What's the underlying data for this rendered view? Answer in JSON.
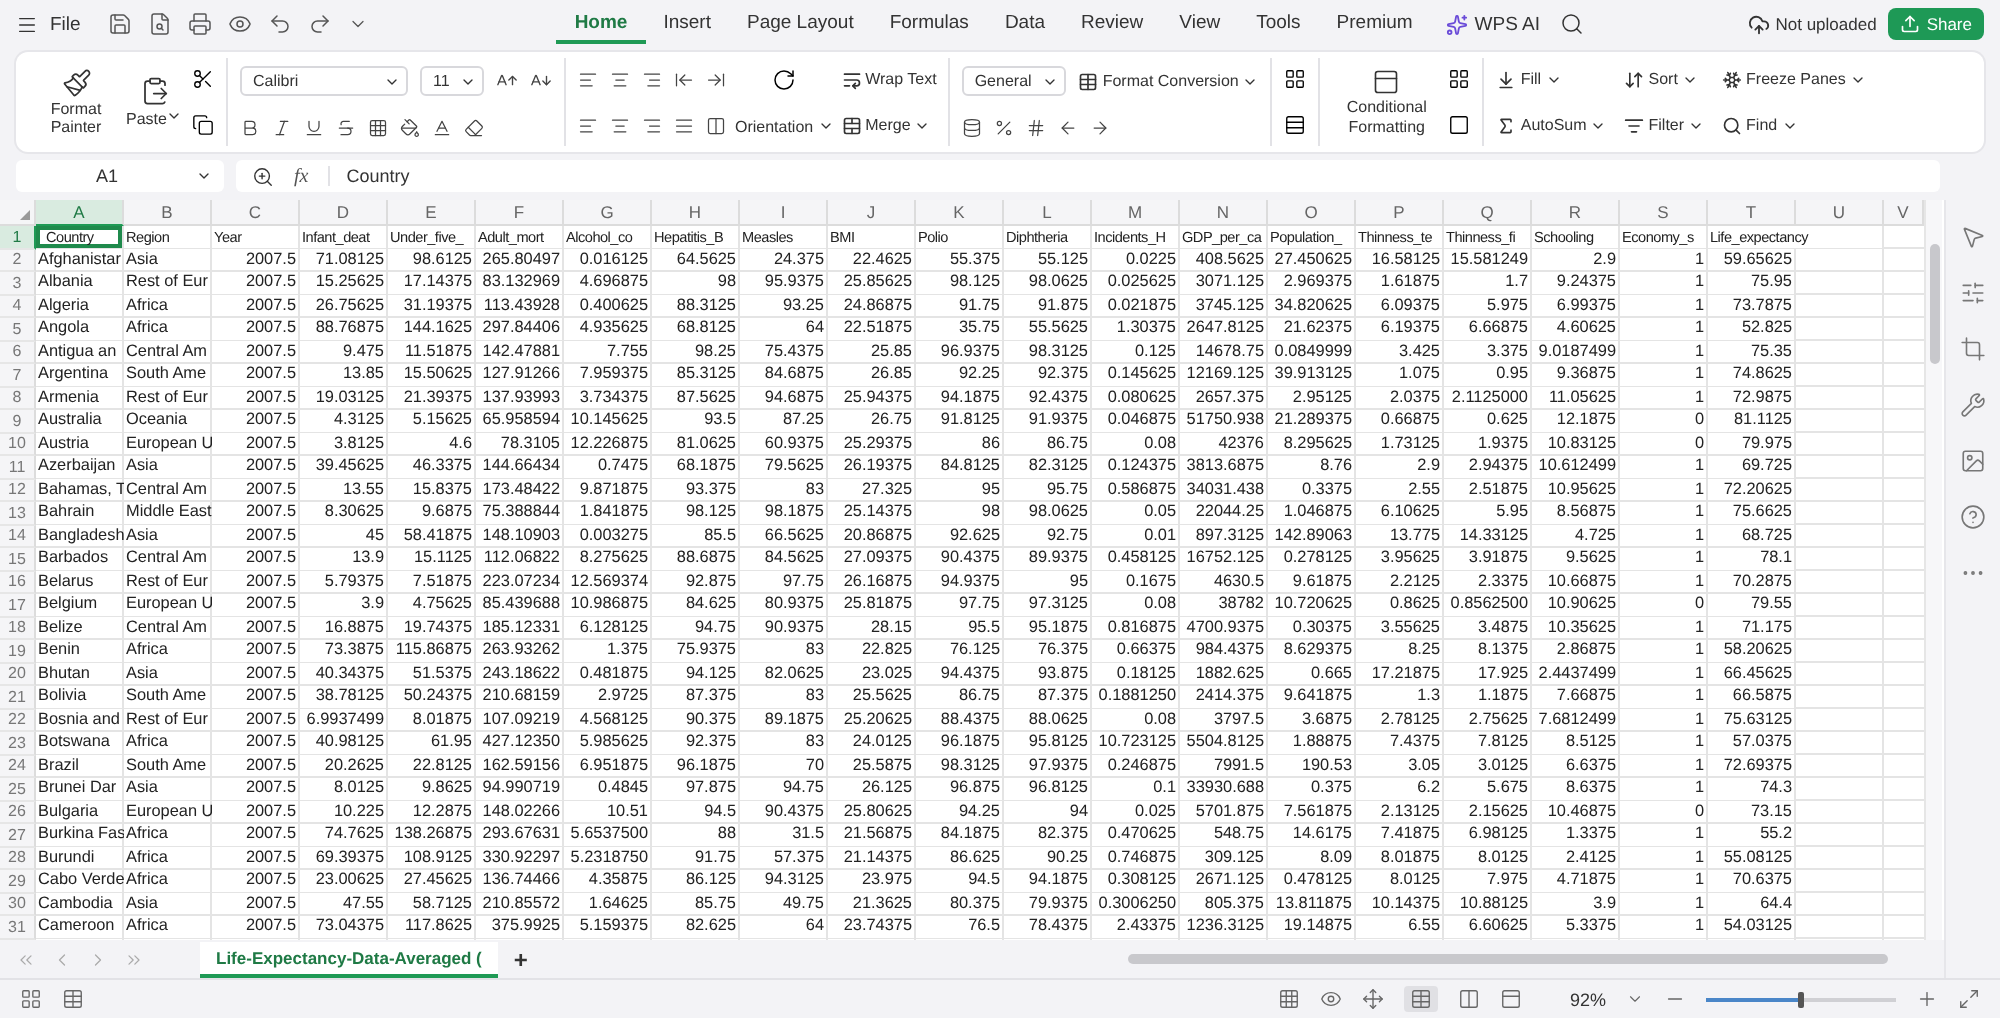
{
  "menu": {
    "file": "File",
    "tabs": [
      {
        "label": "Home",
        "selected": true
      },
      {
        "label": "Insert",
        "selected": false
      },
      {
        "label": "Page Layout",
        "selected": false
      },
      {
        "label": "Formulas",
        "selected": false
      },
      {
        "label": "Data",
        "selected": false
      },
      {
        "label": "Review",
        "selected": false
      },
      {
        "label": "View",
        "selected": false
      },
      {
        "label": "Tools",
        "selected": false
      },
      {
        "label": "Premium",
        "selected": false
      }
    ],
    "ai": "WPS AI",
    "cloud_status": "Not uploaded",
    "share": "Share"
  },
  "ribbon": {
    "format_painter": "Format Painter",
    "paste": "Paste",
    "font": "Calibri",
    "font_size": "11",
    "wrap_text": "Wrap Text",
    "orientation": "Orientation",
    "merge": "Merge",
    "number_format": "General",
    "format_conversion": "Format Conversion",
    "conditional_formatting": "Conditional Formatting",
    "fill": "Fill",
    "autosum": "AutoSum",
    "sort": "Sort",
    "filter": "Filter",
    "freeze_panes": "Freeze Panes",
    "find": "Find"
  },
  "formula_bar": {
    "name_box": "A1",
    "function_label": "fx",
    "value": "Country"
  },
  "sheet": {
    "columns": [
      {
        "letter": "A",
        "selected": true
      },
      {
        "letter": "B",
        "selected": false
      },
      {
        "letter": "C",
        "selected": false
      },
      {
        "letter": "D",
        "selected": false
      },
      {
        "letter": "E",
        "selected": false
      },
      {
        "letter": "F",
        "selected": false
      },
      {
        "letter": "G",
        "selected": false
      },
      {
        "letter": "H",
        "selected": false
      },
      {
        "letter": "I",
        "selected": false
      },
      {
        "letter": "J",
        "selected": false
      },
      {
        "letter": "K",
        "selected": false
      },
      {
        "letter": "L",
        "selected": false
      },
      {
        "letter": "M",
        "selected": false
      },
      {
        "letter": "N",
        "selected": false
      },
      {
        "letter": "O",
        "selected": false
      },
      {
        "letter": "P",
        "selected": false
      },
      {
        "letter": "Q",
        "selected": false
      },
      {
        "letter": "R",
        "selected": false
      },
      {
        "letter": "S",
        "selected": false
      },
      {
        "letter": "T",
        "selected": false
      },
      {
        "letter": "U",
        "selected": false
      },
      {
        "letter": "V",
        "selected": false
      }
    ],
    "header_row": {
      "number": "1",
      "selected": true,
      "cells": [
        "Country",
        "Region",
        "Year",
        "Infant_deat",
        "Under_five_",
        "Adult_mort",
        "Alcohol_co",
        "Hepatitis_B",
        "Measles",
        "BMI",
        "Polio",
        "Diphtheria",
        "Incidents_H",
        "GDP_per_ca",
        "Population_",
        "Thinness_te",
        "Thinness_fi",
        "Schooling",
        "Economy_s",
        "Life_expectancy"
      ]
    },
    "rows": [
      {
        "number": "2",
        "selected": false,
        "cells": [
          "Afghanistar",
          "Asia",
          "2007.5",
          "71.08125",
          "98.6125",
          "265.80497",
          "0.016125",
          "64.5625",
          "24.375",
          "22.4625",
          "55.375",
          "55.125",
          "0.0225",
          "408.5625",
          "27.450625",
          "16.58125",
          "15.581249",
          "2.9",
          "1",
          "59.65625"
        ]
      },
      {
        "number": "3",
        "selected": false,
        "cells": [
          "Albania",
          "Rest of Eur",
          "2007.5",
          "15.25625",
          "17.14375",
          "83.132969",
          "4.696875",
          "98",
          "95.9375",
          "25.85625",
          "98.125",
          "98.0625",
          "0.025625",
          "3071.125",
          "2.969375",
          "1.61875",
          "1.7",
          "9.24375",
          "1",
          "75.95"
        ]
      },
      {
        "number": "4",
        "selected": false,
        "cells": [
          "Algeria",
          "Africa",
          "2007.5",
          "26.75625",
          "31.19375",
          "113.43928",
          "0.400625",
          "88.3125",
          "93.25",
          "24.86875",
          "91.75",
          "91.875",
          "0.021875",
          "3745.125",
          "34.820625",
          "6.09375",
          "5.975",
          "6.99375",
          "1",
          "73.7875"
        ]
      },
      {
        "number": "5",
        "selected": false,
        "cells": [
          "Angola",
          "Africa",
          "2007.5",
          "88.76875",
          "144.1625",
          "297.84406",
          "4.935625",
          "68.8125",
          "64",
          "22.51875",
          "35.75",
          "55.5625",
          "1.30375",
          "2647.8125",
          "21.62375",
          "6.19375",
          "6.66875",
          "4.60625",
          "1",
          "52.825"
        ]
      },
      {
        "number": "6",
        "selected": false,
        "cells": [
          "Antigua an",
          "Central Am",
          "2007.5",
          "9.475",
          "11.51875",
          "142.47881",
          "7.755",
          "98.25",
          "75.4375",
          "25.85",
          "96.9375",
          "98.3125",
          "0.125",
          "14678.75",
          "0.0849999",
          "3.425",
          "3.375",
          "9.0187499",
          "1",
          "75.35"
        ]
      },
      {
        "number": "7",
        "selected": false,
        "cells": [
          "Argentina",
          "South Ame",
          "2007.5",
          "13.85",
          "15.50625",
          "127.91266",
          "7.959375",
          "85.3125",
          "84.6875",
          "26.85",
          "92.25",
          "92.375",
          "0.145625",
          "12169.125",
          "39.913125",
          "1.075",
          "0.95",
          "9.36875",
          "1",
          "74.8625"
        ]
      },
      {
        "number": "8",
        "selected": false,
        "cells": [
          "Armenia",
          "Rest of Eur",
          "2007.5",
          "19.03125",
          "21.39375",
          "137.93993",
          "3.734375",
          "87.5625",
          "94.6875",
          "25.94375",
          "94.1875",
          "92.4375",
          "0.080625",
          "2657.375",
          "2.95125",
          "2.0375",
          "2.1125000",
          "11.05625",
          "1",
          "72.9875"
        ]
      },
      {
        "number": "9",
        "selected": false,
        "cells": [
          "Australia",
          "Oceania",
          "2007.5",
          "4.3125",
          "5.15625",
          "65.958594",
          "10.145625",
          "93.5",
          "87.25",
          "26.75",
          "91.8125",
          "91.9375",
          "0.046875",
          "51750.938",
          "21.289375",
          "0.66875",
          "0.625",
          "12.1875",
          "0",
          "81.1125"
        ]
      },
      {
        "number": "10",
        "selected": false,
        "cells": [
          "Austria",
          "European U",
          "2007.5",
          "3.8125",
          "4.6",
          "78.3105",
          "12.226875",
          "81.0625",
          "60.9375",
          "25.29375",
          "86",
          "86.75",
          "0.08",
          "42376",
          "8.295625",
          "1.73125",
          "1.9375",
          "10.83125",
          "0",
          "79.975"
        ]
      },
      {
        "number": "11",
        "selected": false,
        "cells": [
          "Azerbaijan",
          "Asia",
          "2007.5",
          "39.45625",
          "46.3375",
          "144.66434",
          "0.7475",
          "68.1875",
          "79.5625",
          "26.19375",
          "84.8125",
          "82.3125",
          "0.124375",
          "3813.6875",
          "8.76",
          "2.9",
          "2.94375",
          "10.612499",
          "1",
          "69.725"
        ]
      },
      {
        "number": "12",
        "selected": false,
        "cells": [
          "Bahamas, T",
          "Central Am",
          "2007.5",
          "13.55",
          "15.8375",
          "173.48422",
          "9.871875",
          "93.375",
          "83",
          "27.325",
          "95",
          "95.75",
          "0.586875",
          "34031.438",
          "0.3375",
          "2.55",
          "2.51875",
          "10.95625",
          "1",
          "72.20625"
        ]
      },
      {
        "number": "13",
        "selected": false,
        "cells": [
          "Bahrain",
          "Middle East",
          "2007.5",
          "8.30625",
          "9.6875",
          "75.388844",
          "1.841875",
          "98.125",
          "98.1875",
          "25.14375",
          "98",
          "98.0625",
          "0.05",
          "22044.25",
          "1.046875",
          "6.10625",
          "5.95",
          "8.56875",
          "1",
          "75.6625"
        ]
      },
      {
        "number": "14",
        "selected": false,
        "cells": [
          "Bangladesh",
          "Asia",
          "2007.5",
          "45",
          "58.41875",
          "148.10903",
          "0.003275",
          "85.5",
          "66.5625",
          "20.86875",
          "92.625",
          "92.75",
          "0.01",
          "897.3125",
          "142.89063",
          "13.775",
          "14.33125",
          "4.725",
          "1",
          "68.725"
        ]
      },
      {
        "number": "15",
        "selected": false,
        "cells": [
          "Barbados",
          "Central Am",
          "2007.5",
          "13.9",
          "15.1125",
          "112.06822",
          "8.275625",
          "88.6875",
          "84.5625",
          "27.09375",
          "90.4375",
          "89.9375",
          "0.458125",
          "16752.125",
          "0.278125",
          "3.95625",
          "3.91875",
          "9.5625",
          "1",
          "78.1"
        ]
      },
      {
        "number": "16",
        "selected": false,
        "cells": [
          "Belarus",
          "Rest of Eur",
          "2007.5",
          "5.79375",
          "7.51875",
          "223.07234",
          "12.569374",
          "92.875",
          "97.75",
          "26.16875",
          "94.9375",
          "95",
          "0.1675",
          "4630.5",
          "9.61875",
          "2.2125",
          "2.3375",
          "10.66875",
          "1",
          "70.2875"
        ]
      },
      {
        "number": "17",
        "selected": false,
        "cells": [
          "Belgium",
          "European U",
          "2007.5",
          "3.9",
          "4.75625",
          "85.439688",
          "10.986875",
          "84.625",
          "80.9375",
          "25.81875",
          "97.75",
          "97.3125",
          "0.08",
          "38782",
          "10.720625",
          "0.8625",
          "0.8562500",
          "10.90625",
          "0",
          "79.55"
        ]
      },
      {
        "number": "18",
        "selected": false,
        "cells": [
          "Belize",
          "Central Am",
          "2007.5",
          "16.8875",
          "19.74375",
          "185.12331",
          "6.128125",
          "94.75",
          "90.9375",
          "28.15",
          "95.5",
          "95.1875",
          "0.816875",
          "4700.9375",
          "0.30375",
          "3.55625",
          "3.4875",
          "10.35625",
          "1",
          "71.175"
        ]
      },
      {
        "number": "19",
        "selected": false,
        "cells": [
          "Benin",
          "Africa",
          "2007.5",
          "73.3875",
          "115.86875",
          "263.93262",
          "1.375",
          "75.9375",
          "83",
          "22.825",
          "76.125",
          "76.375",
          "0.66375",
          "984.4375",
          "8.629375",
          "8.25",
          "8.1375",
          "2.86875",
          "1",
          "58.20625"
        ]
      },
      {
        "number": "20",
        "selected": false,
        "cells": [
          "Bhutan",
          "Asia",
          "2007.5",
          "40.34375",
          "51.5375",
          "243.18622",
          "0.481875",
          "94.125",
          "82.0625",
          "23.025",
          "94.4375",
          "93.875",
          "0.18125",
          "1882.625",
          "0.665",
          "17.21875",
          "17.925",
          "2.4437499",
          "1",
          "66.45625"
        ]
      },
      {
        "number": "21",
        "selected": false,
        "cells": [
          "Bolivia",
          "South Ame",
          "2007.5",
          "38.78125",
          "50.24375",
          "210.68159",
          "2.9725",
          "87.375",
          "83",
          "25.5625",
          "86.75",
          "87.375",
          "0.1881250",
          "2414.375",
          "9.641875",
          "1.3",
          "1.1875",
          "7.66875",
          "1",
          "66.5875"
        ]
      },
      {
        "number": "22",
        "selected": false,
        "cells": [
          "Bosnia and",
          "Rest of Eur",
          "2007.5",
          "6.9937499",
          "8.01875",
          "107.09219",
          "4.568125",
          "90.375",
          "89.1875",
          "25.20625",
          "88.4375",
          "88.0625",
          "0.08",
          "3797.5",
          "3.6875",
          "2.78125",
          "2.75625",
          "7.6812499",
          "1",
          "75.63125"
        ]
      },
      {
        "number": "23",
        "selected": false,
        "cells": [
          "Botswana",
          "Africa",
          "2007.5",
          "40.98125",
          "61.95",
          "427.12350",
          "5.985625",
          "92.375",
          "83",
          "24.0125",
          "96.1875",
          "95.8125",
          "10.723125",
          "5504.8125",
          "1.88875",
          "7.4375",
          "7.8125",
          "8.5125",
          "1",
          "57.0375"
        ]
      },
      {
        "number": "24",
        "selected": false,
        "cells": [
          "Brazil",
          "South Ame",
          "2007.5",
          "20.2625",
          "22.8125",
          "162.59156",
          "6.951875",
          "96.1875",
          "70",
          "25.5875",
          "98.3125",
          "97.9375",
          "0.246875",
          "7991.5",
          "190.53",
          "3.05",
          "3.0125",
          "6.6375",
          "1",
          "72.69375"
        ]
      },
      {
        "number": "25",
        "selected": false,
        "cells": [
          "Brunei Dar",
          "Asia",
          "2007.5",
          "8.0125",
          "9.8625",
          "94.990719",
          "0.4845",
          "97.875",
          "94.75",
          "26.125",
          "96.875",
          "96.8125",
          "0.1",
          "33930.688",
          "0.375",
          "6.2",
          "5.675",
          "8.6375",
          "1",
          "74.3"
        ]
      },
      {
        "number": "26",
        "selected": false,
        "cells": [
          "Bulgaria",
          "European U",
          "2007.5",
          "10.225",
          "12.2875",
          "148.02266",
          "10.51",
          "94.5",
          "90.4375",
          "25.80625",
          "94.25",
          "94",
          "0.025",
          "5701.875",
          "7.561875",
          "2.13125",
          "2.15625",
          "10.46875",
          "0",
          "73.15"
        ]
      },
      {
        "number": "27",
        "selected": false,
        "cells": [
          "Burkina Fas",
          "Africa",
          "2007.5",
          "74.7625",
          "138.26875",
          "293.67631",
          "5.6537500",
          "88",
          "31.5",
          "21.56875",
          "84.1875",
          "82.375",
          "0.470625",
          "548.75",
          "14.6175",
          "7.41875",
          "6.98125",
          "1.3375",
          "1",
          "55.2"
        ]
      },
      {
        "number": "28",
        "selected": false,
        "cells": [
          "Burundi",
          "Africa",
          "2007.5",
          "69.39375",
          "108.9125",
          "330.92297",
          "5.2318750",
          "91.75",
          "57.375",
          "21.14375",
          "86.625",
          "90.25",
          "0.746875",
          "309.125",
          "8.09",
          "8.01875",
          "8.0125",
          "2.4125",
          "1",
          "55.08125"
        ]
      },
      {
        "number": "29",
        "selected": false,
        "cells": [
          "Cabo Verde",
          "Africa",
          "2007.5",
          "23.00625",
          "27.45625",
          "136.74466",
          "4.35875",
          "86.125",
          "94.3125",
          "23.975",
          "94.5",
          "94.1875",
          "0.308125",
          "2671.125",
          "0.478125",
          "8.0125",
          "7.975",
          "4.71875",
          "1",
          "70.6375"
        ]
      },
      {
        "number": "30",
        "selected": false,
        "cells": [
          "Cambodia",
          "Asia",
          "2007.5",
          "47.55",
          "58.7125",
          "210.85572",
          "1.64625",
          "85.75",
          "49.75",
          "21.3625",
          "80.375",
          "79.9375",
          "0.3006250",
          "805.375",
          "13.811875",
          "10.14375",
          "10.88125",
          "3.9",
          "1",
          "64.4"
        ]
      },
      {
        "number": "31",
        "selected": false,
        "cells": [
          "Cameroon",
          "Africa",
          "2007.5",
          "73.04375",
          "117.8625",
          "375.9925",
          "5.159375",
          "82.625",
          "64",
          "23.74375",
          "76.5",
          "78.4375",
          "2.43375",
          "1236.3125",
          "19.14875",
          "6.55",
          "6.60625",
          "5.3375",
          "1",
          "54.03125"
        ]
      }
    ]
  },
  "sheet_tabs": {
    "tabs": [
      {
        "label": "Life-Expectancy-Data-Averaged (",
        "selected": true
      }
    ],
    "add": "+"
  },
  "status_bar": {
    "zoom": "92%",
    "zoom_level": {
      "level": 0.5
    }
  }
}
